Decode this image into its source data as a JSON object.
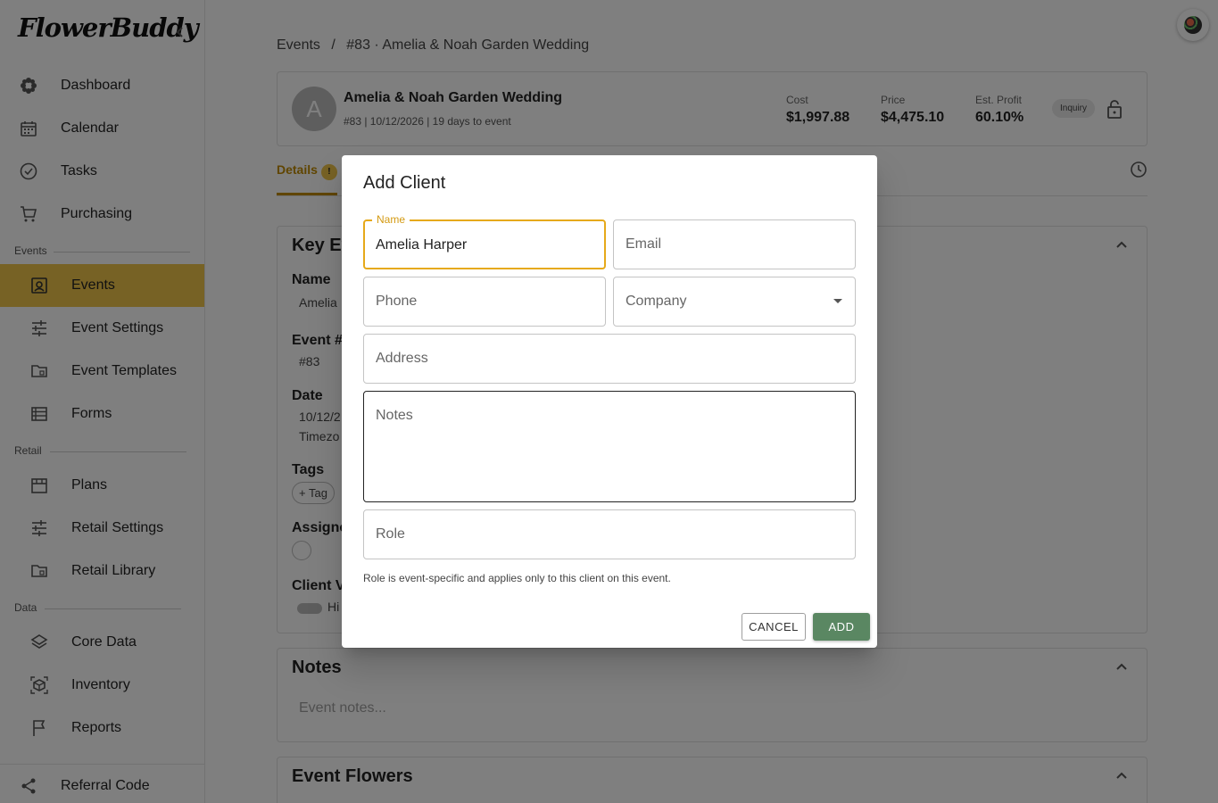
{
  "sidebar": {
    "logo": "FlowerBuddy",
    "items": [
      {
        "label": "Dashboard",
        "icon": "flower-icon"
      },
      {
        "label": "Calendar",
        "icon": "calendar-icon"
      },
      {
        "label": "Tasks",
        "icon": "check-circle-icon"
      },
      {
        "label": "Purchasing",
        "icon": "cart-icon"
      }
    ],
    "sections": {
      "events": {
        "label": "Events",
        "items": [
          {
            "label": "Events",
            "icon": "event-icon"
          },
          {
            "label": "Event Settings",
            "icon": "sliders-icon"
          },
          {
            "label": "Event Templates",
            "icon": "folder-icon"
          },
          {
            "label": "Forms",
            "icon": "list-icon"
          }
        ]
      },
      "retail": {
        "label": "Retail",
        "items": [
          {
            "label": "Plans",
            "icon": "store-icon"
          },
          {
            "label": "Retail Settings",
            "icon": "sliders-icon"
          },
          {
            "label": "Retail Library",
            "icon": "folder-icon"
          }
        ]
      },
      "data": {
        "label": "Data",
        "items": [
          {
            "label": "Core Data",
            "icon": "layers-icon"
          },
          {
            "label": "Inventory",
            "icon": "box-icon"
          },
          {
            "label": "Reports",
            "icon": "flag-icon"
          }
        ]
      }
    },
    "referral": {
      "label": "Referral Code",
      "icon": "share-icon"
    }
  },
  "breadcrumb": {
    "root": "Events",
    "sep": "/",
    "current": "#83 · Amelia & Noah Garden Wedding"
  },
  "event": {
    "avatar_letter": "A",
    "title": "Amelia & Noah Garden Wedding",
    "subtitle": "#83 | 10/12/2026 | 19 days to event",
    "cost_label": "Cost",
    "cost": "$1,997.88",
    "price_label": "Price",
    "price": "$4,475.10",
    "profit_label": "Est. Profit",
    "profit": "60.10%",
    "status": "Inquiry"
  },
  "tabs": {
    "details": "Details",
    "details_badge": "!"
  },
  "key_event": {
    "title": "Key Ev",
    "name_k": "Name",
    "name_v": "Amelia",
    "num_k": "Event #",
    "num_v": "#83",
    "date_k": "Date",
    "date_v": "10/12/2",
    "tz_v": "Timezo",
    "tags_k": "Tags",
    "tag_btn": "+ Tag",
    "assign_k": "Assigne",
    "client_k": "Client V",
    "client_v": "Hi"
  },
  "notes_panel": {
    "title": "Notes",
    "placeholder": "Event notes..."
  },
  "flowers_panel": {
    "title": "Event Flowers"
  },
  "dialog": {
    "title": "Add Client",
    "name_label": "Name",
    "name_value": "Amelia Harper",
    "email_ph": "Email",
    "phone_ph": "Phone",
    "company_ph": "Company",
    "address_ph": "Address",
    "notes_ph": "Notes",
    "role_ph": "Role",
    "helper": "Role is event-specific and applies only to this client on this event.",
    "cancel": "CANCEL",
    "add": "ADD"
  },
  "colors": {
    "accent": "#eec44a",
    "accent_text": "#c08b00",
    "focus": "#e6a91a",
    "add_button": "#5a8762"
  }
}
